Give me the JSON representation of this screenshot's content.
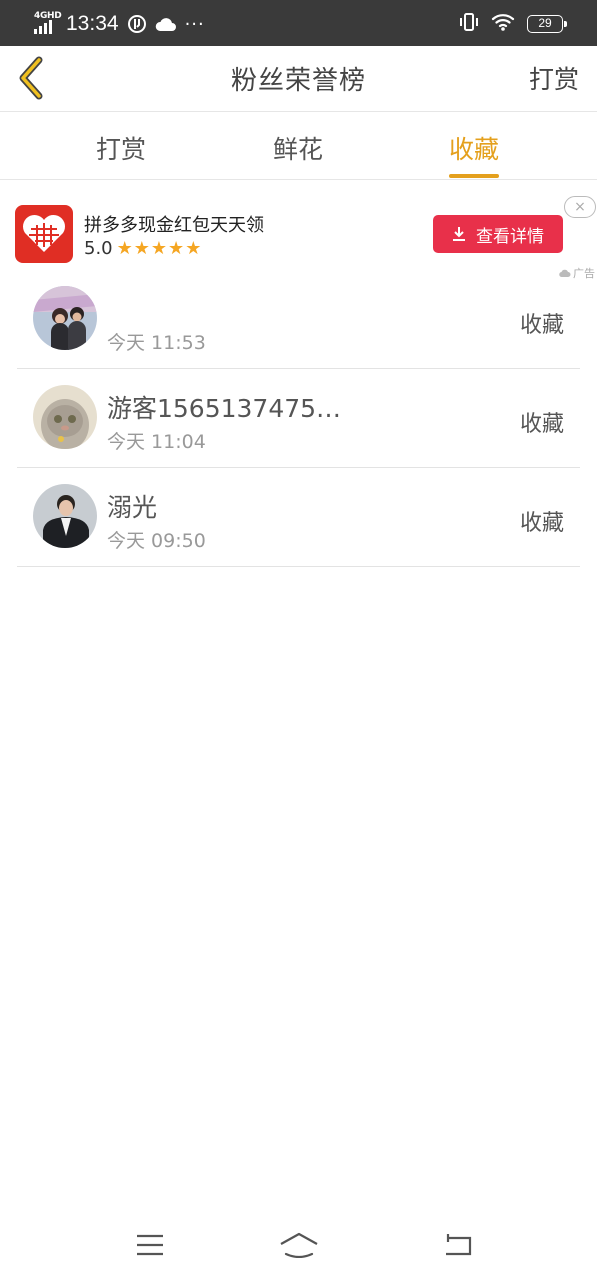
{
  "status_bar": {
    "network": "4GHD",
    "time": "13:34",
    "more": "···",
    "battery": "29",
    "icons": [
      "signal-icon",
      "data-saver-icon",
      "cloud-icon",
      "vibrate-icon",
      "wifi-icon",
      "battery-icon"
    ]
  },
  "header": {
    "title": "粉丝荣誉榜",
    "action_label": "打赏",
    "accent_color": "#e4a01d"
  },
  "tabs": [
    {
      "label": "打赏",
      "active": false
    },
    {
      "label": "鲜花",
      "active": false
    },
    {
      "label": "收藏",
      "active": true
    }
  ],
  "ad": {
    "title": "拼多多现金红包天天领",
    "rating": "5.0",
    "stars": "★★★★★",
    "button_label": "查看详情",
    "close_label": "×",
    "tag": "广告",
    "button_color": "#e8304a"
  },
  "list": [
    {
      "name": "",
      "time": "今天 11:53",
      "action": "收藏",
      "avatar": "couple-photo"
    },
    {
      "name": "游客1565137475…",
      "time": "今天 11:04",
      "action": "收藏",
      "avatar": "cat-photo"
    },
    {
      "name": "溺光",
      "time": "今天 09:50",
      "action": "收藏",
      "avatar": "man-in-suit-photo"
    }
  ],
  "nav_bar": {
    "icons": [
      "menu-icon",
      "home-icon",
      "back-icon"
    ]
  }
}
